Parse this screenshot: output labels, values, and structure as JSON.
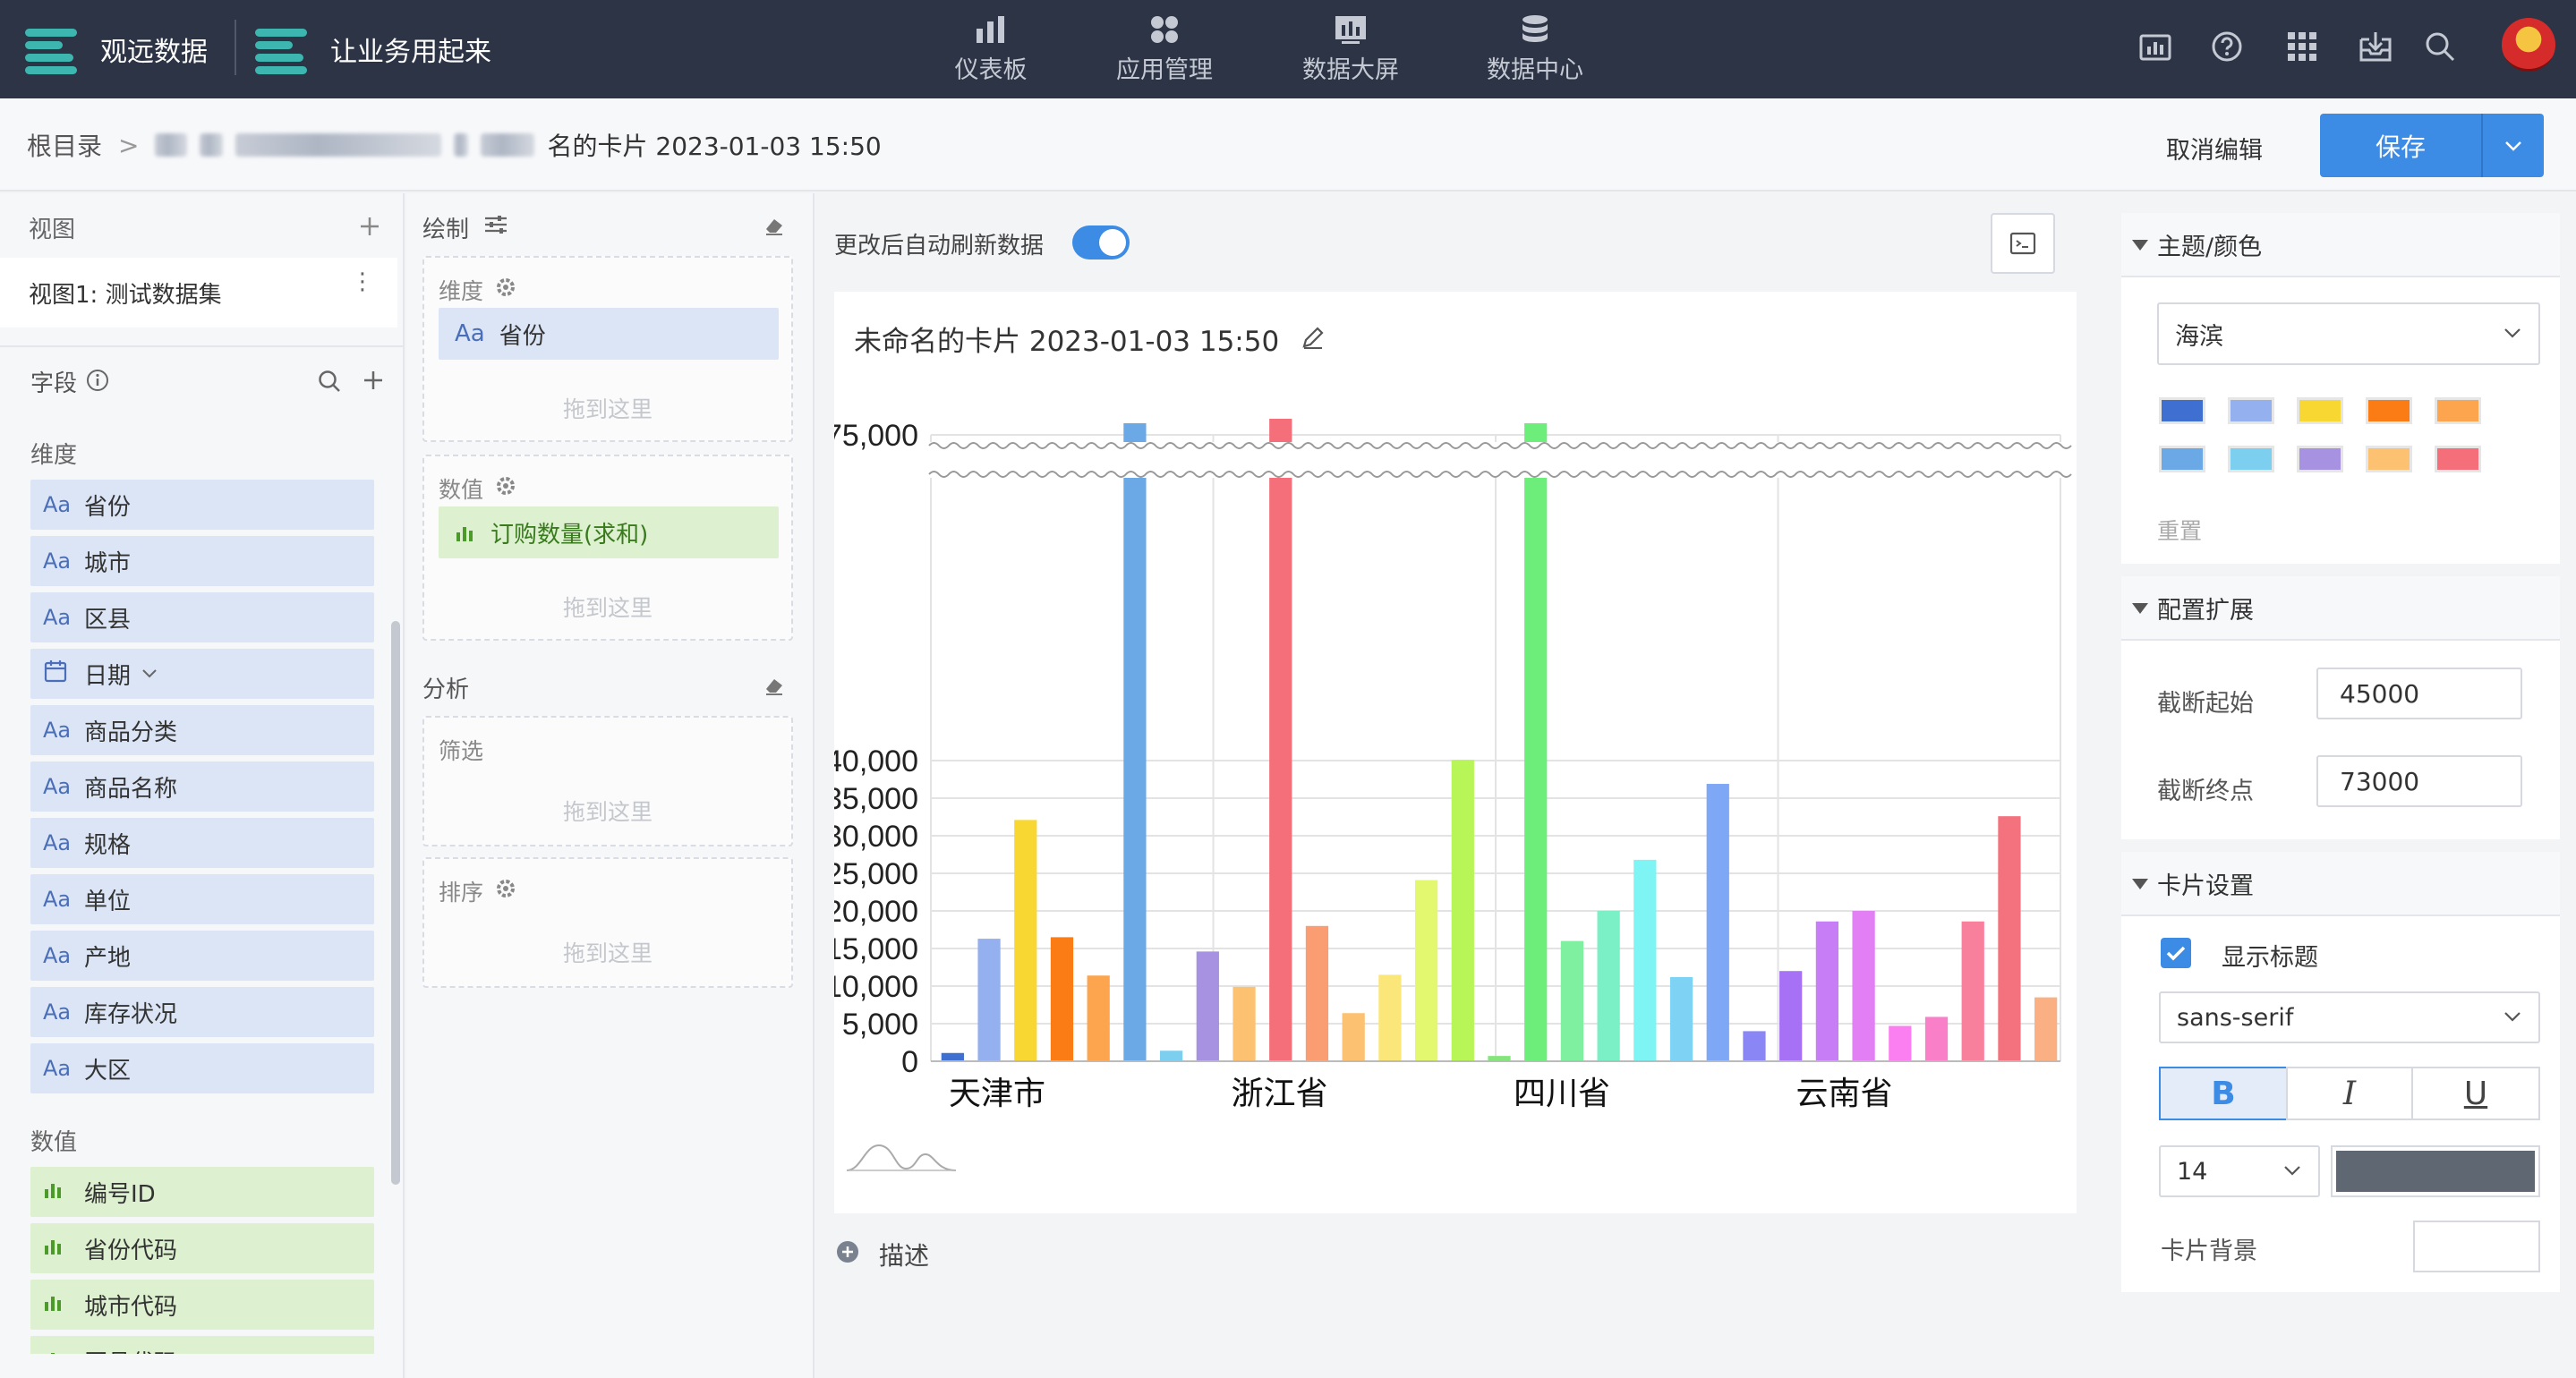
{
  "topbar": {
    "brand1": "观远数据",
    "brand2": "让业务用起来",
    "nav": [
      {
        "label": "仪表板",
        "icon": "dashboard-icon"
      },
      {
        "label": "应用管理",
        "icon": "apps-icon"
      },
      {
        "label": "数据大屏",
        "icon": "big-screen-icon"
      },
      {
        "label": "数据中心",
        "icon": "data-center-icon"
      }
    ],
    "tools": [
      "report-icon",
      "help-icon",
      "grid-icon",
      "inbox-download-icon",
      "search-icon"
    ]
  },
  "breadcrumb": {
    "root": "根目录",
    "sep": ">",
    "current": "名的卡片 2023-01-03 15:50",
    "cancel": "取消编辑",
    "save": "保存"
  },
  "left": {
    "views_title": "视图",
    "view_item": "视图1: 测试数据集",
    "fields_title": "字段",
    "dim_title": "维度",
    "dims": [
      "省份",
      "城市",
      "区县",
      "日期",
      "商品分类",
      "商品名称",
      "规格",
      "单位",
      "产地",
      "库存状况",
      "大区"
    ],
    "metric_title": "数值",
    "metrics": [
      "编号ID",
      "省份代码",
      "城市代码",
      "区县代码"
    ],
    "aa": "Aa"
  },
  "mid": {
    "draw_title": "绘制",
    "dim_label": "维度",
    "dim_value": "省份",
    "drop_hint": "拖到这里",
    "val_label": "数值",
    "val_value": "订购数量(求和)",
    "analysis_title": "分析",
    "filter_label": "筛选",
    "sort_label": "排序"
  },
  "center": {
    "auto_refresh": "更改后自动刷新数据",
    "card_title": "未命名的卡片 2023-01-03 15:50",
    "desc": "描述"
  },
  "chart_data": {
    "type": "bar",
    "title": "未命名的卡片 2023-01-03 15:50",
    "axis_break": [
      45000,
      73000
    ],
    "yticks_lower": [
      "0",
      "5,000",
      "10,000",
      "15,000",
      "20,000",
      "25,000",
      "30,000",
      "35,000",
      "40,000"
    ],
    "ytick_upper": "75,000",
    "x_labels": [
      "天津市",
      "浙江省",
      "四川省",
      "云南省"
    ],
    "values": [
      1100,
      16300,
      32100,
      16500,
      11400,
      74000,
      1400,
      14600,
      9900,
      76000,
      18000,
      6400,
      11500,
      24100,
      40100,
      700,
      74000,
      16000,
      20000,
      26800,
      11200,
      36900,
      4000,
      12000,
      18600,
      20000,
      4700,
      5900,
      18600,
      32600,
      8500
    ],
    "colors": [
      "#3f6fd0",
      "#94b0ee",
      "#f9d732",
      "#fb7b14",
      "#fda54e",
      "#6aa9e6",
      "#7ccfee",
      "#a692e0",
      "#fcc171",
      "#f56f7a",
      "#fb9d72",
      "#fcc171",
      "#fbe67a",
      "#e3f86f",
      "#b8f657",
      "#84e57a",
      "#6ded7a",
      "#7ff0a0",
      "#7bf0c7",
      "#7ff4f4",
      "#7ed3f5",
      "#7ea8f5",
      "#8a86f5",
      "#a671f5",
      "#c67df5",
      "#e37ff5",
      "#fb7ff0",
      "#f87fc8",
      "#f8809d",
      "#f3727e",
      "#fbb084"
    ]
  },
  "right": {
    "theme_title": "主题/颜色",
    "theme_value": "海滨",
    "palette": [
      "#3f6fd0",
      "#94b0ee",
      "#f9d732",
      "#fb7b14",
      "#fda54e",
      "#6aa9e6",
      "#7ccfee",
      "#a692e0",
      "#fcc171",
      "#f56f7a"
    ],
    "reset": "重置",
    "ext_title": "配置扩展",
    "break_start_label": "截断起始",
    "break_start": "45000",
    "break_end_label": "截断终点",
    "break_end": "73000",
    "card_title": "卡片设置",
    "show_title": "显示标题",
    "font_family": "sans-serif",
    "bold": "B",
    "italic": "I",
    "underline": "U",
    "font_size": "14",
    "text_color": "#5f6773",
    "bg_label": "卡片背景"
  }
}
